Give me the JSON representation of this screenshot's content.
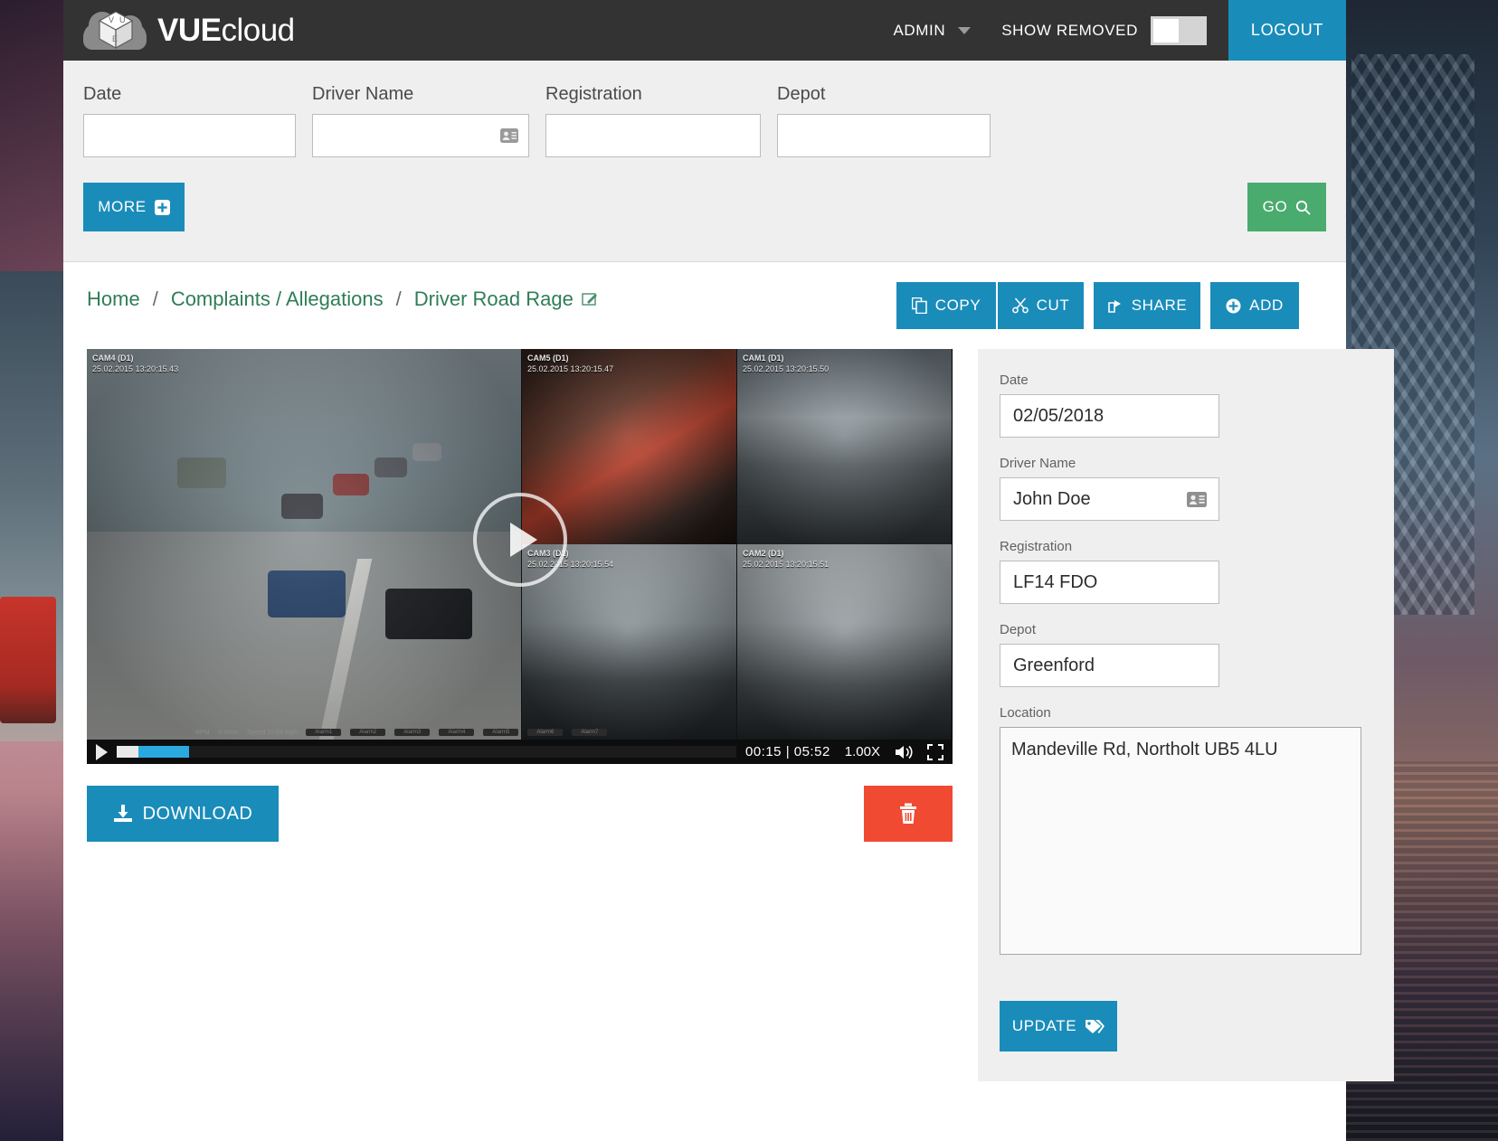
{
  "header": {
    "brand_bold": "VUE",
    "brand_light": "cloud",
    "logo_icon": "vue-cube-cloud-logo",
    "admin_label": "ADMIN",
    "caret_icon": "chevron-down-icon",
    "show_removed_label": "SHOW REMOVED",
    "show_removed_state": "off",
    "logout_label": "LOGOUT",
    "bar_color": "#333333",
    "accent_color": "#1a8cba"
  },
  "filters": {
    "fields": [
      {
        "label": "Date",
        "value": "",
        "placeholder": "",
        "name": "date"
      },
      {
        "label": "Driver Name",
        "value": "",
        "placeholder": "",
        "name": "driver-name",
        "icon": "contact-card-icon"
      },
      {
        "label": "Registration",
        "value": "",
        "placeholder": "",
        "name": "registration"
      },
      {
        "label": "Depot",
        "value": "",
        "placeholder": "",
        "name": "depot"
      }
    ],
    "more_label": "MORE",
    "more_icon": "plus-square-icon",
    "go_label": "GO",
    "go_icon": "search-icon",
    "go_color": "#4aab6e"
  },
  "breadcrumb": {
    "home": "Home",
    "sep1": "/",
    "section": "Complaints / Allegations",
    "sep2": "/",
    "current": "Driver Road Rage",
    "edit_icon": "edit-pencil-icon",
    "link_color": "#2f7d56"
  },
  "actions": [
    {
      "label": "COPY",
      "icon": "copy-icon"
    },
    {
      "label": "CUT",
      "icon": "scissors-icon"
    },
    {
      "label": "SHARE",
      "icon": "share-icon"
    },
    {
      "label": "ADD",
      "icon": "plus-circle-icon"
    }
  ],
  "video": {
    "cameras": [
      {
        "id": "CAM4 (D1)",
        "timestamp": "25.02.2015  13:20:15.43"
      },
      {
        "id": "CAM5 (D1)",
        "timestamp": "25.02.2015  13:20:15.47"
      },
      {
        "id": "CAM1 (D1)",
        "timestamp": "25.02.2015  13:20:15.50"
      },
      {
        "id": "CAM3 (D1)",
        "timestamp": "25.02.2015  13:20:15.54"
      },
      {
        "id": "CAM2 (D1)",
        "timestamp": "25.02.2015  13:20:15.51"
      }
    ],
    "play_icon": "play-circle-overlay-icon",
    "current_time": "00:15",
    "duration": "05:52",
    "time_display": "00:15 | 05:52",
    "speed": "1.00X",
    "volume_icon": "volume-icon",
    "fullscreen_icon": "fullscreen-icon",
    "telemetry": {
      "rpm": "RPM",
      "engine": "0 r/min",
      "speed": "Speed 10.64  mph",
      "alarms": [
        "Alarm1",
        "Alarm2",
        "Alarm3",
        "Alarm4",
        "Alarm5",
        "Alarm6",
        "Alarm7"
      ]
    },
    "download_label": "DOWNLOAD",
    "download_icon": "download-icon",
    "delete_icon": "trash-icon",
    "delete_color": "#f04a32"
  },
  "details": {
    "fields": [
      {
        "label": "Date",
        "value": "02/05/2018",
        "name": "date"
      },
      {
        "label": "Driver Name",
        "value": "John Doe",
        "name": "driver-name",
        "icon": "contact-card-icon"
      },
      {
        "label": "Registration",
        "value": "LF14 FDO",
        "name": "registration"
      },
      {
        "label": "Depot",
        "value": "Greenford",
        "name": "depot"
      }
    ],
    "location_label": "Location",
    "location_value": "Mandeville Rd, Northolt UB5 4LU",
    "update_label": "UPDATE",
    "update_icon": "tags-icon"
  }
}
